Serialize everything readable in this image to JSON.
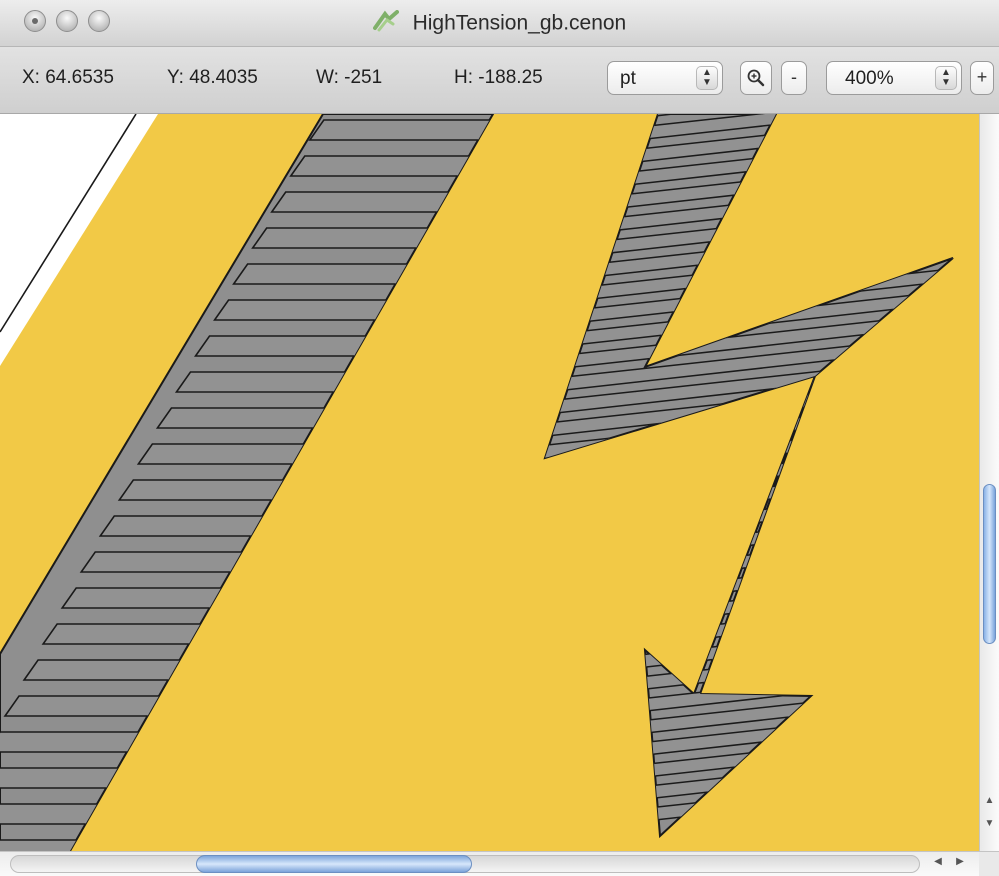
{
  "window": {
    "title": "HighTension_gb.cenon",
    "document_icon": "cenon-document-icon",
    "traffic_lights": [
      "close-icon",
      "minimize-icon",
      "zoom-icon"
    ]
  },
  "toolbar": {
    "x_label": "X:",
    "x_value": "64.6535",
    "y_label": "Y:",
    "y_value": "48.4035",
    "w_label": "W:",
    "w_value": "-251",
    "h_label": "H:",
    "h_value": "-188.25",
    "unit_selected": "pt",
    "zoom_in_icon": "magnifier-plus-icon",
    "zoom_out_label": "-",
    "zoom_selected": "400%",
    "plus_label": "+"
  },
  "canvas": {
    "background_color": "#ffffff",
    "sign_color": "#f2c946",
    "stripe_color": "#8f8f8f",
    "outline_color": "#1a1a1a"
  },
  "scrollbars": {
    "vertical_position": 0.45,
    "horizontal_position": 0.2
  }
}
